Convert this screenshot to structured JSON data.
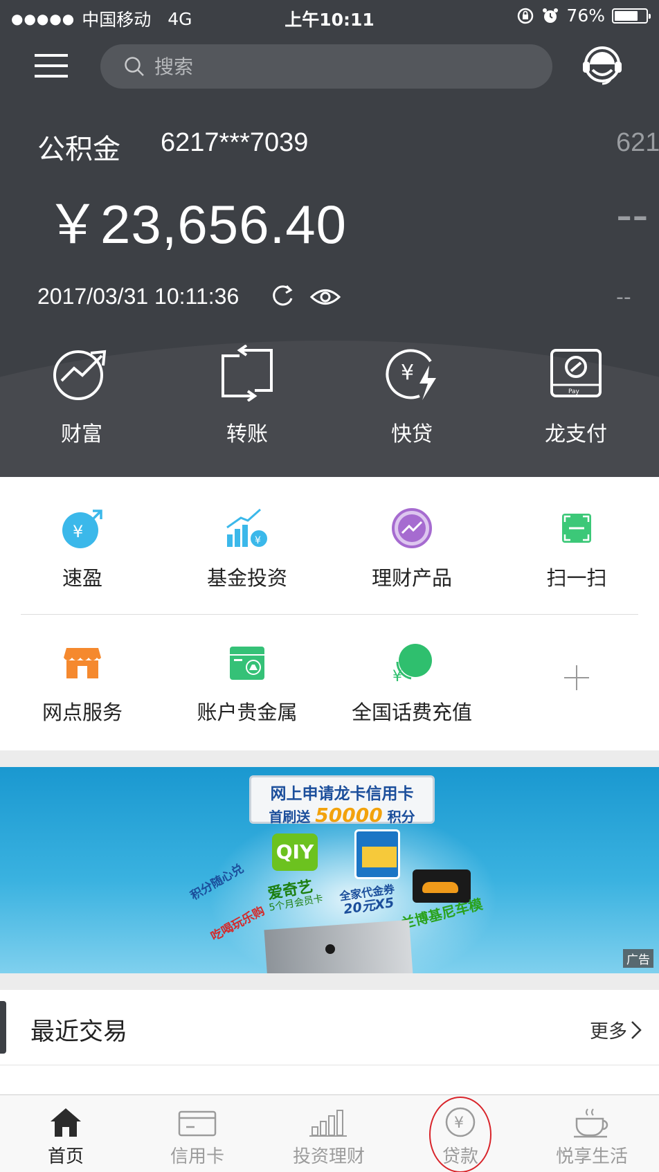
{
  "status_bar": {
    "signal_dots": "●●●●●",
    "carrier": "中国移动",
    "network": "4G",
    "time": "上午10:11",
    "battery": "76%",
    "battery_level": 0.76,
    "icons": [
      "orientation-lock-icon",
      "alarm-icon",
      "battery-icon"
    ]
  },
  "header": {
    "search_placeholder": "搜索",
    "icons": [
      "menu-icon",
      "search-icon",
      "customer-service-icon"
    ]
  },
  "account": {
    "type": "公积金",
    "number": "6217***7039",
    "balance": "￥23,656.40",
    "updated": "2017/03/31 10:11:36",
    "next_number": "621",
    "next_balance": "--",
    "next_updated": "--"
  },
  "quick_actions": [
    {
      "label": "财富",
      "icon": "wealth-icon"
    },
    {
      "label": "转账",
      "icon": "transfer-icon"
    },
    {
      "label": "快贷",
      "icon": "quick-loan-icon"
    },
    {
      "label": "龙支付",
      "icon": "long-pay-icon"
    }
  ],
  "services": {
    "row1": [
      {
        "label": "速盈",
        "icon": "suying-icon"
      },
      {
        "label": "基金投资",
        "icon": "fund-icon"
      },
      {
        "label": "理财产品",
        "icon": "wealth-product-icon"
      },
      {
        "label": "扫一扫",
        "icon": "scan-icon"
      }
    ],
    "row2": [
      {
        "label": "网点服务",
        "icon": "branch-icon"
      },
      {
        "label": "账户贵金属",
        "icon": "precious-metal-icon"
      },
      {
        "label": "全国话费充值",
        "icon": "phone-topup-icon"
      },
      {
        "label": "",
        "icon": "add-icon"
      }
    ]
  },
  "banner": {
    "title": "网上申请龙卡信用卡",
    "sub_prefix": "首刷送",
    "points": "50000",
    "sub_suffix": "积分",
    "iqiyi_logo": "QIY",
    "iqiyi_text": "爱奇艺",
    "iqiyi_sub": "5个月会员卡",
    "familymart_text": "全家代金券",
    "familymart_sub": "20元X5",
    "lamborghini_text": "兰博基尼车模",
    "points_slogan": "积分随心兑",
    "fun_slogan": "吃喝玩乐购",
    "ad_tag": "广告"
  },
  "recent": {
    "title": "最近交易",
    "more": "更多"
  },
  "tab_bar": [
    {
      "label": "首页",
      "icon": "home-icon",
      "active": true
    },
    {
      "label": "信用卡",
      "icon": "credit-card-icon",
      "active": false
    },
    {
      "label": "投资理财",
      "icon": "investment-icon",
      "active": false
    },
    {
      "label": "贷款",
      "icon": "loan-icon",
      "active": false
    },
    {
      "label": "悦享生活",
      "icon": "lifestyle-icon",
      "active": false
    }
  ],
  "colors": {
    "header_bg": "#3d4045",
    "annotation_circle": "#d8242a",
    "suying": "#3bb8ea",
    "fund": "#3bb8ea",
    "wealth_product": "#a66bd0",
    "scan": "#3cc878",
    "branch": "#f5892e",
    "precious_metal": "#35c177",
    "phone_topup": "#2fbf6e"
  }
}
